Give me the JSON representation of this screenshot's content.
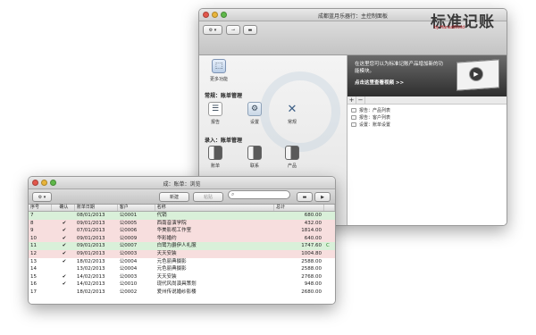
{
  "control_panel": {
    "title": "成都蓝月乐器行：主控制面板",
    "toolbar": {
      "gear": "⚙ ▾",
      "key": "⊸",
      "card": "▬"
    },
    "brand": {
      "name": "标准记账",
      "sub": "by HansaWorld"
    },
    "more_label": "更多功能",
    "section_regular": "常规：账单管理",
    "regular_items": [
      "报告",
      "设置",
      "常规"
    ],
    "section_entry": "录入：账单管理",
    "entry_items": [
      "账单",
      "联系",
      "产品"
    ],
    "promo": {
      "text": "在这里您可以为标准记账产品增加新的功能模块。",
      "link": "点击这里查看视频 >>"
    },
    "pm": {
      "plus": "+",
      "minus": "−"
    },
    "list": [
      "报告：产品列表",
      "报告：客户列表",
      "设置：账单设置"
    ]
  },
  "browse": {
    "title": "成：账单：浏览",
    "toolbar": {
      "gear": "⚙ ▾",
      "new": "新建",
      "paste": "粘贴",
      "search_placeholder": ""
    },
    "headers": [
      "序号",
      "确认",
      "账单日期",
      "客户",
      "名称",
      "总计"
    ],
    "rows": [
      {
        "no": "7",
        "ok": "",
        "date": "08/01/2013",
        "cust": "公0001",
        "name": "代销",
        "total": "680.00",
        "flag": "",
        "color": "green"
      },
      {
        "no": "8",
        "ok": "✔",
        "date": "09/01/2013",
        "cust": "公0005",
        "name": "西南音演学院",
        "total": "432.00",
        "flag": "",
        "color": "red"
      },
      {
        "no": "9",
        "ok": "✔",
        "date": "07/01/2013",
        "cust": "公0006",
        "name": "华美影视工作室",
        "total": "1814.00",
        "flag": "",
        "color": "red"
      },
      {
        "no": "10",
        "ok": "✔",
        "date": "09/01/2013",
        "cust": "公0009",
        "name": "华彩婚约",
        "total": "640.00",
        "flag": "",
        "color": "red"
      },
      {
        "no": "11",
        "ok": "✔",
        "date": "09/01/2013",
        "cust": "公0007",
        "name": "白鹭为爵伊人礼服",
        "total": "1747.60",
        "flag": "C",
        "color": "green"
      },
      {
        "no": "12",
        "ok": "✔",
        "date": "09/01/2013",
        "cust": "公0003",
        "name": "天天安装",
        "total": "1004.80",
        "flag": "",
        "color": "red"
      },
      {
        "no": "13",
        "ok": "✔",
        "date": "18/02/2013",
        "cust": "公0004",
        "name": "元色丽典摄影",
        "total": "2588.00",
        "flag": "",
        "color": "white"
      },
      {
        "no": "14",
        "ok": "",
        "date": "13/02/2013",
        "cust": "公0004",
        "name": "元色丽典摄影",
        "total": "2588.00",
        "flag": "",
        "color": "white"
      },
      {
        "no": "15",
        "ok": "✔",
        "date": "14/02/2013",
        "cust": "公0003",
        "name": "天天安装",
        "total": "2768.00",
        "flag": "",
        "color": "white"
      },
      {
        "no": "16",
        "ok": "✔",
        "date": "14/02/2013",
        "cust": "公0010",
        "name": "现代风尚演具策划",
        "total": "948.00",
        "flag": "",
        "color": "white"
      },
      {
        "no": "17",
        "ok": "",
        "date": "18/02/2013",
        "cust": "公0002",
        "name": "爱州传说婚纱影楼",
        "total": "2680.00",
        "flag": "",
        "color": "white"
      }
    ]
  }
}
